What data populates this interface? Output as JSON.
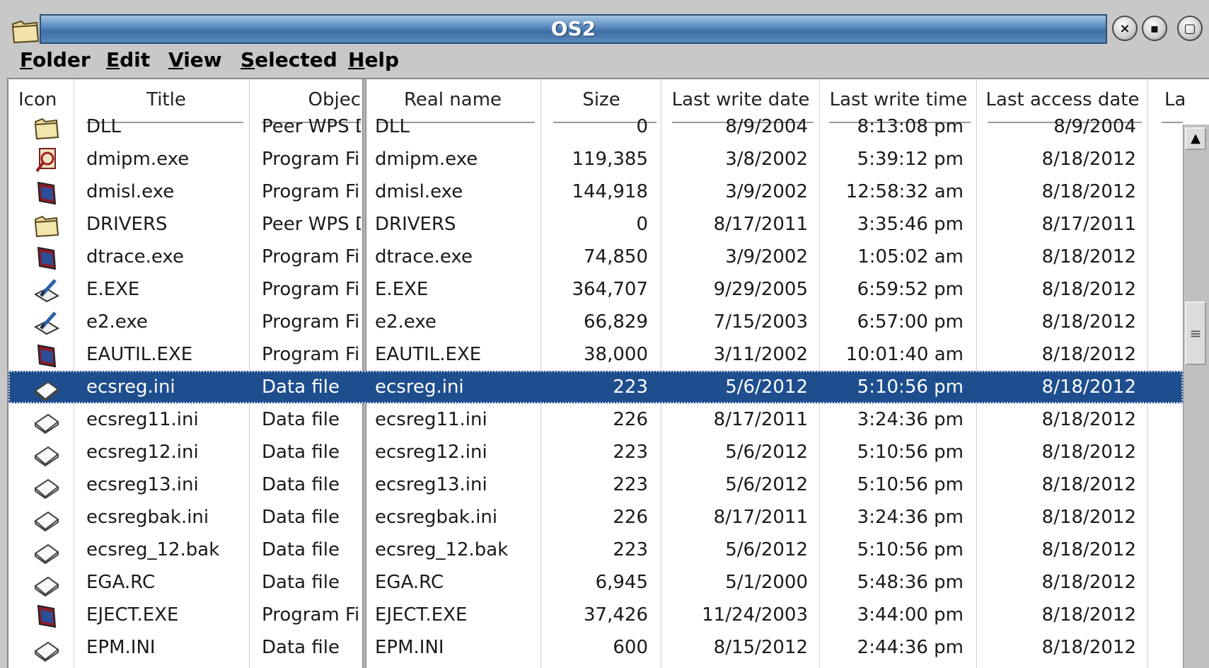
{
  "window": {
    "title": "OS2",
    "close_glyph": "×",
    "minimize_glyph": "▪",
    "maximize_glyph": "▢"
  },
  "menu": [
    {
      "mnemonic": "F",
      "rest": "older"
    },
    {
      "mnemonic": "E",
      "rest": "dit"
    },
    {
      "mnemonic": "V",
      "rest": "iew"
    },
    {
      "mnemonic": "S",
      "rest": "elected"
    },
    {
      "mnemonic": "H",
      "rest": "elp"
    }
  ],
  "columns": {
    "icon": "Icon",
    "title": "Title",
    "object": "Objec",
    "real_name": "Real name",
    "size": "Size",
    "last_write_date": "Last write date",
    "last_write_time": "Last write time",
    "last_access_date": "Last access date",
    "last_col": "Last a"
  },
  "rows": [
    {
      "icon": "folder-icon",
      "title": "DLL",
      "object": "Peer WPS Di",
      "real_name": "DLL",
      "size": "0",
      "write_date": "8/9/2004",
      "write_time": "8:13:08 pm",
      "access_date": "8/9/2004",
      "selected": false
    },
    {
      "icon": "program-magnifier-icon",
      "title": "dmipm.exe",
      "object": "Program File",
      "real_name": "dmipm.exe",
      "size": "119,385",
      "write_date": "3/8/2002",
      "write_time": "5:39:12 pm",
      "access_date": "8/18/2012",
      "selected": false
    },
    {
      "icon": "program-window-icon",
      "title": "dmisl.exe",
      "object": "Program File",
      "real_name": "dmisl.exe",
      "size": "144,918",
      "write_date": "3/9/2002",
      "write_time": "12:58:32 am",
      "access_date": "8/18/2012",
      "selected": false
    },
    {
      "icon": "folder-icon",
      "title": "DRIVERS",
      "object": "Peer WPS Di",
      "real_name": "DRIVERS",
      "size": "0",
      "write_date": "8/17/2011",
      "write_time": "3:35:46 pm",
      "access_date": "8/17/2011",
      "selected": false
    },
    {
      "icon": "program-window-icon",
      "title": "dtrace.exe",
      "object": "Program File",
      "real_name": "dtrace.exe",
      "size": "74,850",
      "write_date": "3/9/2002",
      "write_time": "1:05:02 am",
      "access_date": "8/18/2012",
      "selected": false
    },
    {
      "icon": "editor-pen-icon",
      "title": "E.EXE",
      "object": "Program File",
      "real_name": "E.EXE",
      "size": "364,707",
      "write_date": "9/29/2005",
      "write_time": "6:59:52 pm",
      "access_date": "8/18/2012",
      "selected": false
    },
    {
      "icon": "editor-pen-icon",
      "title": "e2.exe",
      "object": "Program File",
      "real_name": "e2.exe",
      "size": "66,829",
      "write_date": "7/15/2003",
      "write_time": "6:57:00 pm",
      "access_date": "8/18/2012",
      "selected": false
    },
    {
      "icon": "program-window-icon",
      "title": "EAUTIL.EXE",
      "object": "Program File",
      "real_name": "EAUTIL.EXE",
      "size": "38,000",
      "write_date": "3/11/2002",
      "write_time": "10:01:40 am",
      "access_date": "8/18/2012",
      "selected": false
    },
    {
      "icon": "data-file-icon",
      "title": "ecsreg.ini",
      "object": "Data file",
      "real_name": "ecsreg.ini",
      "size": "223",
      "write_date": "5/6/2012",
      "write_time": "5:10:56 pm",
      "access_date": "8/18/2012",
      "selected": true
    },
    {
      "icon": "data-file-icon",
      "title": "ecsreg11.ini",
      "object": "Data file",
      "real_name": "ecsreg11.ini",
      "size": "226",
      "write_date": "8/17/2011",
      "write_time": "3:24:36 pm",
      "access_date": "8/18/2012",
      "selected": false
    },
    {
      "icon": "data-file-icon",
      "title": "ecsreg12.ini",
      "object": "Data file",
      "real_name": "ecsreg12.ini",
      "size": "223",
      "write_date": "5/6/2012",
      "write_time": "5:10:56 pm",
      "access_date": "8/18/2012",
      "selected": false
    },
    {
      "icon": "data-file-icon",
      "title": "ecsreg13.ini",
      "object": "Data file",
      "real_name": "ecsreg13.ini",
      "size": "223",
      "write_date": "5/6/2012",
      "write_time": "5:10:56 pm",
      "access_date": "8/18/2012",
      "selected": false
    },
    {
      "icon": "data-file-icon",
      "title": "ecsregbak.ini",
      "object": "Data file",
      "real_name": "ecsregbak.ini",
      "size": "226",
      "write_date": "8/17/2011",
      "write_time": "3:24:36 pm",
      "access_date": "8/18/2012",
      "selected": false
    },
    {
      "icon": "data-file-icon",
      "title": "ecsreg_12.bak",
      "object": "Data file",
      "real_name": "ecsreg_12.bak",
      "size": "223",
      "write_date": "5/6/2012",
      "write_time": "5:10:56 pm",
      "access_date": "8/18/2012",
      "selected": false
    },
    {
      "icon": "data-file-icon",
      "title": "EGA.RC",
      "object": "Data file",
      "real_name": "EGA.RC",
      "size": "6,945",
      "write_date": "5/1/2000",
      "write_time": "5:48:36 pm",
      "access_date": "8/18/2012",
      "selected": false
    },
    {
      "icon": "program-window-icon",
      "title": "EJECT.EXE",
      "object": "Program File",
      "real_name": "EJECT.EXE",
      "size": "37,426",
      "write_date": "11/24/2003",
      "write_time": "3:44:00 pm",
      "access_date": "8/18/2012",
      "selected": false
    },
    {
      "icon": "data-file-icon",
      "title": "EPM.INI",
      "object": "Data file",
      "real_name": "EPM.INI",
      "size": "600",
      "write_date": "8/15/2012",
      "write_time": "2:44:36 pm",
      "access_date": "8/18/2012",
      "selected": false
    }
  ],
  "scrollbar": {
    "up_glyph": "▲",
    "thumb_glyph": "≡"
  },
  "colors": {
    "title_bar": "#3d6fa6",
    "selection": "#1e4e8e",
    "chrome": "#c8c8c8"
  }
}
